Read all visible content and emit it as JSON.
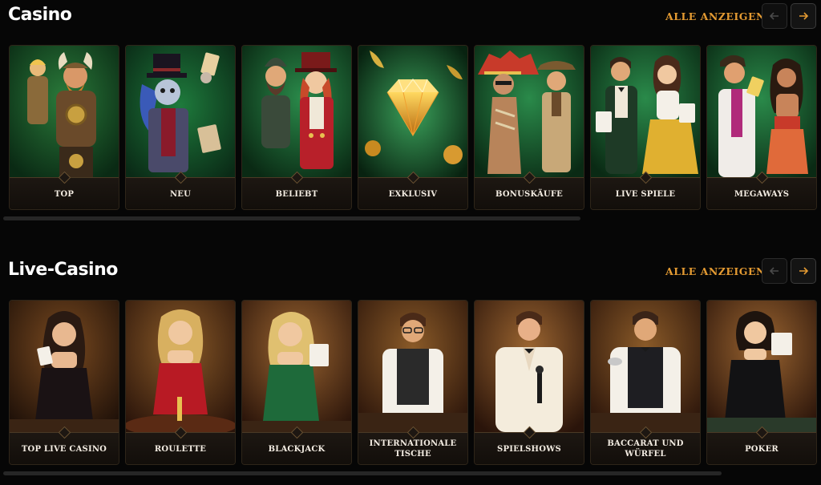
{
  "casino": {
    "title": "Casino",
    "show_all": "ALLE ANZEIGEN",
    "cards": [
      {
        "label": "TOP",
        "icon": "viking-warriors-art"
      },
      {
        "label": "NEU",
        "icon": "top-hat-skeleton-art"
      },
      {
        "label": "BELIEBT",
        "icon": "gnome-and-ringmaster-art"
      },
      {
        "label": "EXKLUSIV",
        "icon": "golden-diamond-art"
      },
      {
        "label": "BONUSKÄUFE",
        "icon": "aztec-warrior-explorer-art"
      },
      {
        "label": "LIVE SPIELE",
        "icon": "dealer-couple-art"
      },
      {
        "label": "MEGAWAYS",
        "icon": "jester-and-princess-art"
      }
    ]
  },
  "live_casino": {
    "title": "Live-Casino",
    "show_all": "ALLE ANZEIGEN",
    "cards": [
      {
        "label": "TOP LIVE CASINO",
        "icon": "dealer-woman-cards-art"
      },
      {
        "label": "ROULETTE",
        "icon": "roulette-dealer-art"
      },
      {
        "label": "BLACKJACK",
        "icon": "blackjack-dealer-art"
      },
      {
        "label": "INTERNATIONALE TISCHE",
        "icon": "dealer-glasses-art"
      },
      {
        "label": "SPIELSHOWS",
        "icon": "show-host-microphone-art"
      },
      {
        "label": "BACCARAT UND WÜRFEL",
        "icon": "baccarat-dealer-art"
      },
      {
        "label": "POKER",
        "icon": "poker-dealer-art"
      }
    ]
  },
  "colors": {
    "accent": "#e39a32",
    "background": "#060606",
    "card_footer": "#1d1712"
  }
}
